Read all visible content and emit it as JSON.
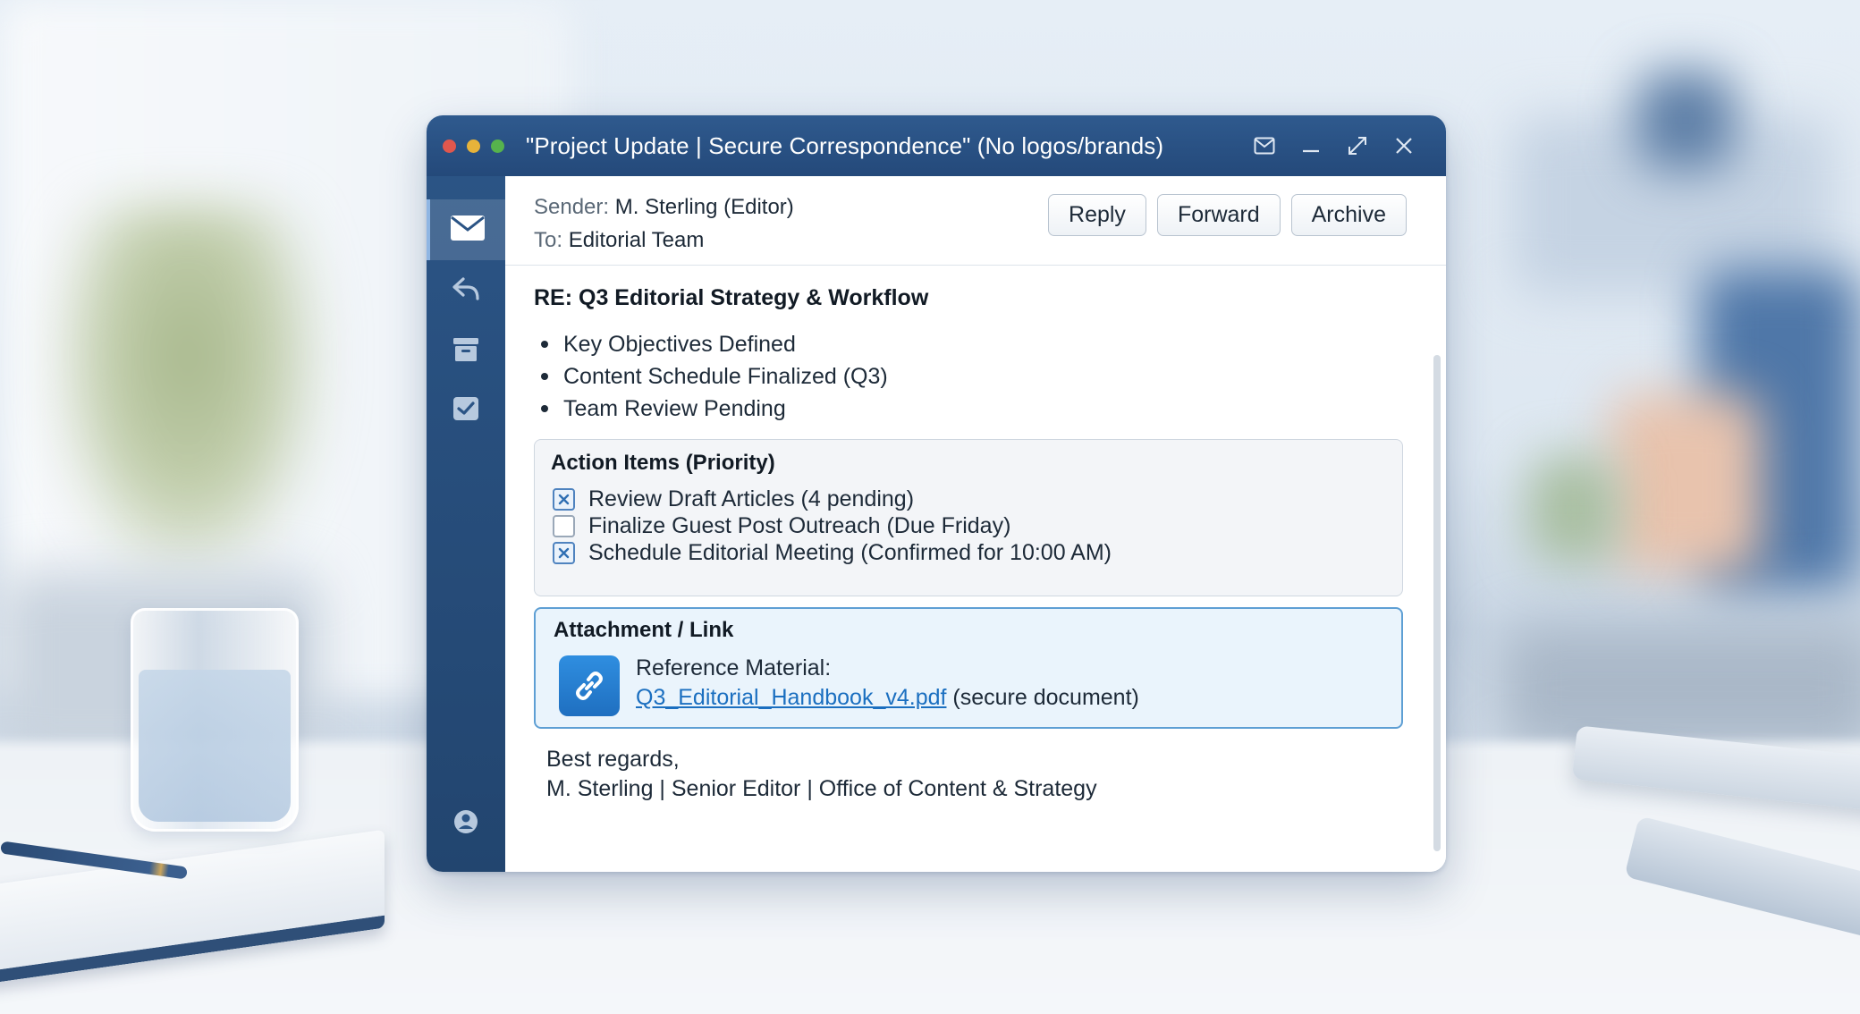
{
  "window": {
    "title": "\"Project Update | Secure Correspondence\" (No logos/brands)"
  },
  "titlebar_icons": [
    "mail-icon",
    "minimize-icon",
    "expand-icon",
    "close-icon"
  ],
  "sidebar": {
    "items": [
      {
        "icon": "envelope-icon",
        "active": true
      },
      {
        "icon": "reply-icon",
        "active": false
      },
      {
        "icon": "archive-icon",
        "active": false
      },
      {
        "icon": "mail-check-icon",
        "active": false
      }
    ],
    "bottom_icon": "account-icon"
  },
  "message": {
    "sender_label": "Sender:",
    "sender": "M. Sterling (Editor)",
    "to_label": "To:",
    "to": "Editorial Team",
    "subject": "RE: Q3 Editorial Strategy & Workflow",
    "bullets": [
      "Key Objectives Defined",
      "Content Schedule Finalized (Q3)",
      "Team Review Pending"
    ]
  },
  "toolbar": {
    "reply_label": "Reply",
    "forward_label": "Forward",
    "archive_label": "Archive"
  },
  "action_items": {
    "heading": "Action Items (Priority)",
    "items": [
      {
        "label": "Review Draft Articles (4 pending)",
        "checked": true
      },
      {
        "label": "Finalize Guest Post Outreach (Due Friday)",
        "checked": false
      },
      {
        "label": "Schedule Editorial Meeting (Confirmed for 10:00 AM)",
        "checked": true
      }
    ]
  },
  "attachment": {
    "heading": "Attachment / Link",
    "ref_label": "Reference Material:",
    "file_name": "Q3_Editorial_Handbook_v4.pdf",
    "file_note": "(secure document)",
    "icon": "link-icon"
  },
  "signature": {
    "closing": "Best regards,",
    "line": "M. Sterling | Senior Editor | Office of Content & Strategy"
  },
  "colors": {
    "titlebar": "#2f5a8e",
    "sidebar": "#2b5485",
    "link": "#1b6fc0",
    "attachment_border": "#5e9fd4"
  }
}
